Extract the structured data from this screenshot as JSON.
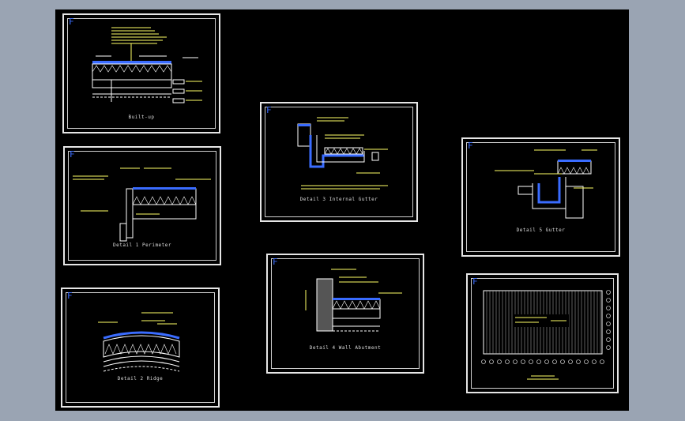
{
  "app": {
    "background": "#9aa4b3",
    "canvas": "#000000",
    "accent": "#3a6cff"
  },
  "sheets": [
    {
      "id": "s1",
      "flag": "F",
      "caption": "Built-up"
    },
    {
      "id": "s2",
      "flag": "F",
      "caption": "Detail 3 Internal Gutter"
    },
    {
      "id": "s3",
      "flag": "F",
      "caption": "Detail 5 Gutter"
    },
    {
      "id": "s4",
      "flag": "F",
      "caption": "Detail 1 Perimeter"
    },
    {
      "id": "s5",
      "flag": "F",
      "caption": "Detail 2 Ridge"
    },
    {
      "id": "s6",
      "flag": "F",
      "caption": "Detail 4 Wall Abutment"
    },
    {
      "id": "s7",
      "flag": "F",
      "caption": ""
    }
  ],
  "icons": {
    "flag": "f-marker-icon"
  }
}
